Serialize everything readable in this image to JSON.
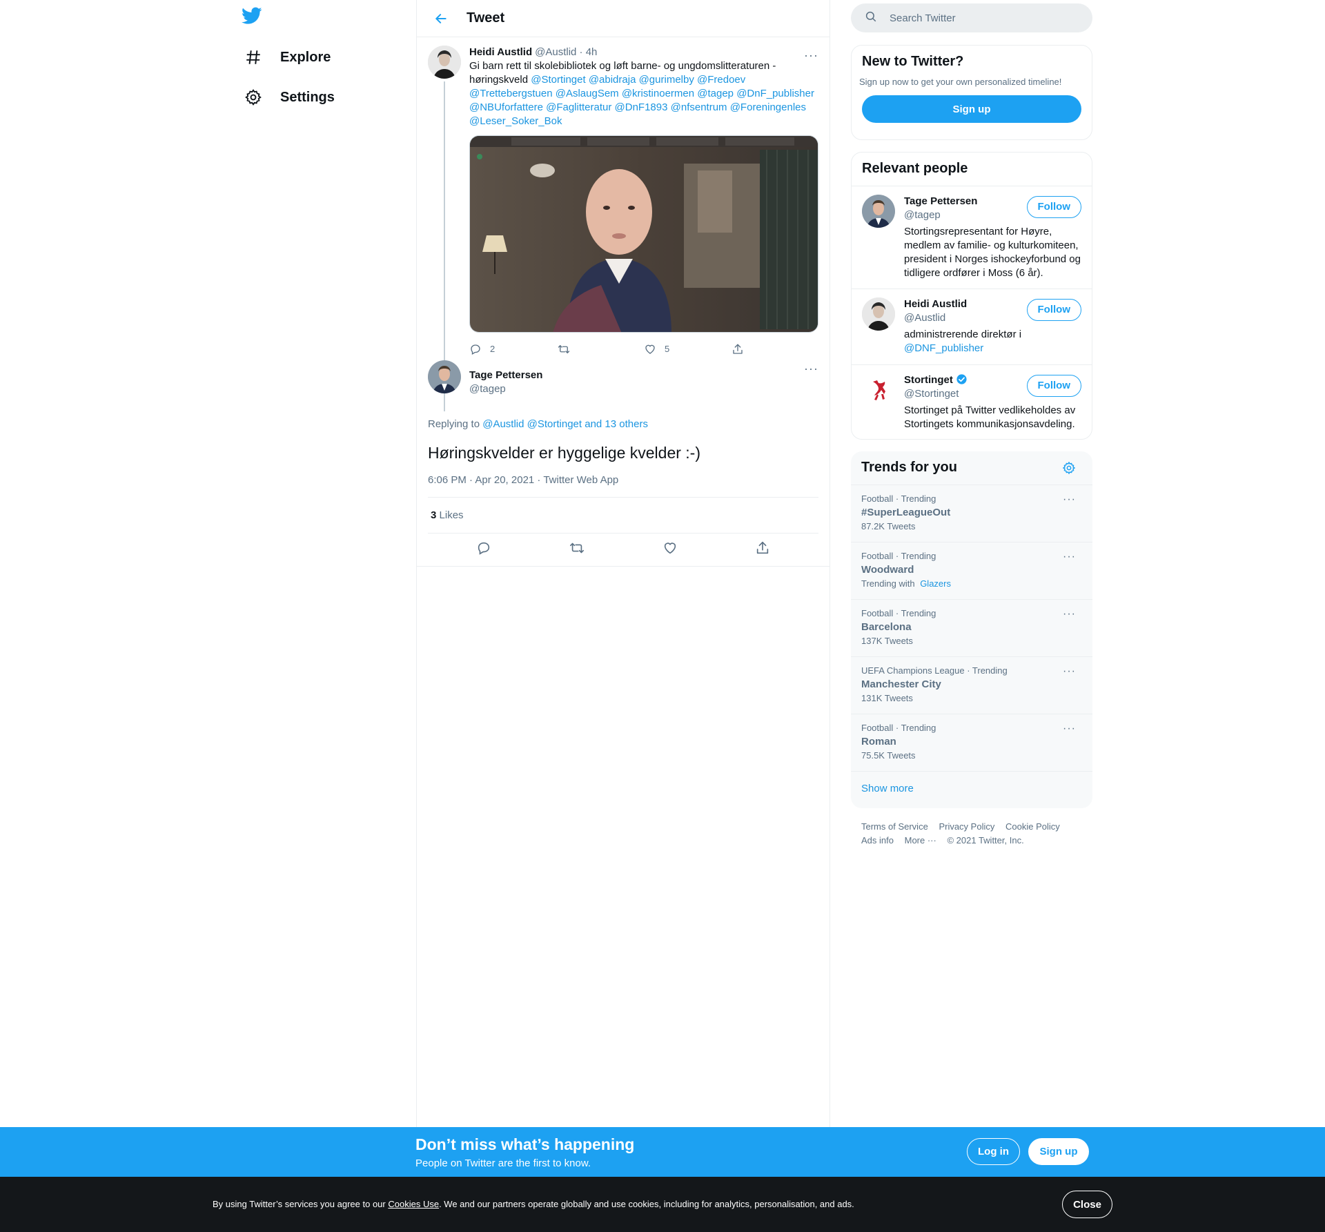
{
  "nav": {
    "items": [
      {
        "label": "Explore",
        "icon": "hashtag-icon"
      },
      {
        "label": "Settings",
        "icon": "gear-icon"
      }
    ]
  },
  "header": {
    "title": "Tweet"
  },
  "parent_tweet": {
    "name": "Heidi Austlid",
    "meta": "@Austlid · 4h",
    "text_plain": "Gi barn rett til skolebibliotek og løft barne- og ungdomslitteraturen - høringskveld",
    "mentions": "@Stortinget @abidraja @gurimelby @Fredoev @Trettebergstuen @AslaugSem @kristinoermen @tagep @DnF_publisher @NBUforfattere @Faglitteratur @DnF1893 @nfsentrum @Foreningenles @Leser_Soker_Bok",
    "reply_count": "2",
    "like_count": "5"
  },
  "main_tweet": {
    "name": "Tage Pettersen",
    "handle": "@tagep",
    "replying_label": "Replying to",
    "replying_to": "@Austlid @Stortinget and 13 others",
    "text": "Høringskvelder er hyggelige kvelder :-)",
    "date": "6:06 PM · Apr 20, 2021 · Twitter Web App",
    "likes_count": "3",
    "likes_label": "Likes"
  },
  "search": {
    "placeholder": "Search Twitter"
  },
  "new_to_twitter": {
    "title": "New to Twitter?",
    "subtitle": "Sign up now to get your own personalized timeline!",
    "button": "Sign up"
  },
  "relevant_people": {
    "title": "Relevant people",
    "follow_label": "Follow",
    "people": [
      {
        "name": "Tage Pettersen",
        "handle": "@tagep",
        "bio": "Stortingsrepresentant for Høyre, medlem av familie- og kulturkomiteen, president i Norges ishockeyforbund og tidligere ordfører i Moss (6 år)."
      },
      {
        "name": "Heidi Austlid",
        "handle": "@Austlid",
        "bio": "administrerende direktør i",
        "bio_link": "@DNF_publisher"
      },
      {
        "name": "Stortinget",
        "handle": "@Stortinget",
        "bio": "Stortinget på Twitter vedlikeholdes av Stortingets kommunikasjonsavdeling.",
        "verified": true
      }
    ]
  },
  "trends": {
    "title": "Trends for you",
    "items": [
      {
        "context": "Football · Trending",
        "name": "#SuperLeagueOut",
        "count": "87.2K Tweets"
      },
      {
        "context": "Football · Trending",
        "name": "Woodward",
        "count": "Trending with",
        "with": "Glazers"
      },
      {
        "context": "Football · Trending",
        "name": "Barcelona",
        "count": "137K Tweets"
      },
      {
        "context": "UEFA Champions League · Trending",
        "name": "Manchester City",
        "count": "131K Tweets"
      },
      {
        "context": "Football · Trending",
        "name": "Roman",
        "count": "75.5K Tweets"
      }
    ],
    "show_more": "Show more"
  },
  "footer": {
    "links": [
      "Terms of Service",
      "Privacy Policy",
      "Cookie Policy",
      "Ads info",
      "More ···",
      "© 2021 Twitter, Inc."
    ]
  },
  "banner": {
    "title": "Don’t miss what’s happening",
    "subtitle": "People on Twitter are the first to know.",
    "login": "Log in",
    "signup": "Sign up"
  },
  "cookie": {
    "before": "By using Twitter’s services you agree to our ",
    "link": "Cookies Use",
    "after": ". We and our partners operate globally and use cookies, including for analytics, personalisation, and ads.",
    "close": "Close"
  },
  "colors": {
    "accent": "#1da1f2",
    "link": "#1b95e0",
    "secondary_text": "#5b7083",
    "cookie_bg": "#14171a"
  }
}
